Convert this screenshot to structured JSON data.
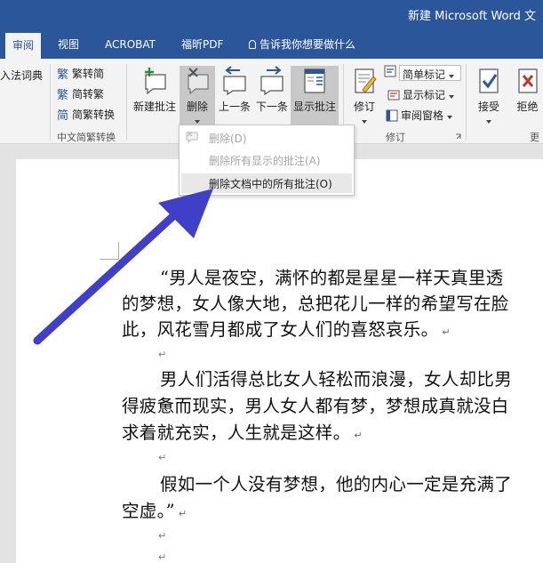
{
  "window": {
    "title": "新建 Microsoft Word 文"
  },
  "tabs": [
    {
      "label": "审阅",
      "active": true
    },
    {
      "label": "视图"
    },
    {
      "label": "ACROBAT"
    },
    {
      "label": "福昕PDF"
    }
  ],
  "tell_me": {
    "label": "告诉我你想要做什么"
  },
  "ribbon": {
    "partial_left_label": "入法词典",
    "chinese_conversion": {
      "to_simplified": "繁转简",
      "to_traditional": "简转繁",
      "convert": "简繁转换",
      "group_label": "中文简繁转换"
    },
    "comments": {
      "new_comment": "新建批注",
      "delete": "删除",
      "previous": "上一条",
      "next": "下一条",
      "show_comments": "显示批注"
    },
    "tracking": {
      "track_changes": "修订",
      "markup_option": "简单标记",
      "show_markup": "显示标记",
      "reviewing_pane": "审阅窗格",
      "group_label": "修订"
    },
    "changes": {
      "accept": "接受",
      "reject": "拒绝",
      "partial_group_label": "更"
    }
  },
  "delete_menu": {
    "items": [
      {
        "label": "删除(D)",
        "enabled": false
      },
      {
        "label": "删除所有显示的批注(A)",
        "enabled": false
      },
      {
        "label": "删除文档中的所有批注(O)",
        "enabled": true
      }
    ]
  },
  "document": {
    "lines": [
      "“男人是夜空，满怀的都是星星一样天真里透",
      "的梦想，女人像大地，总把花儿一样的希望写在脸",
      "此，风花雪月都成了女人们的喜怒哀乐。",
      "男人们活得总比女人轻松而浪漫，女人却比男",
      "得疲惫而现实，男人女人都有梦，梦想成真就没白",
      "求着就充实，人生就是这样。",
      "假如一个人没有梦想，他的内心一定是充满了",
      "空虚。”"
    ]
  },
  "colors": {
    "accent": "#2b579a",
    "annotation_arrow": "#3f3fc8"
  }
}
